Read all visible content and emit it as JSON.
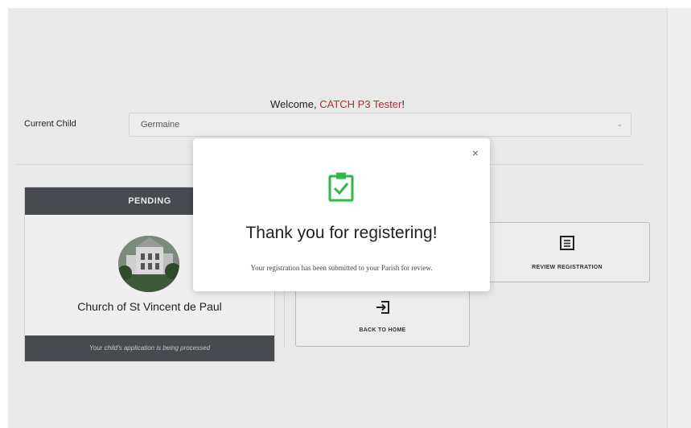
{
  "header": {
    "welcome_prefix": "Welcome, ",
    "user_name": "CATCH P3 Tester",
    "welcome_suffix": "!"
  },
  "child_selector": {
    "label": "Current Child",
    "value": "Germaine"
  },
  "status_card": {
    "status": "PENDING",
    "church_name": "Church of St Vincent de Paul",
    "footer_note": "Your child's application is being processed"
  },
  "actions": {
    "review_label": "REVIEW REGISTRATION",
    "home_label": "BACK TO HOME"
  },
  "modal": {
    "close_glyph": "×",
    "title": "Thank you for registering!",
    "message": "Your registration has been submitted to your Parish for review."
  },
  "colors": {
    "accent_red": "#c0272d",
    "success_green": "#2db84a",
    "card_header": "#474b4f"
  }
}
